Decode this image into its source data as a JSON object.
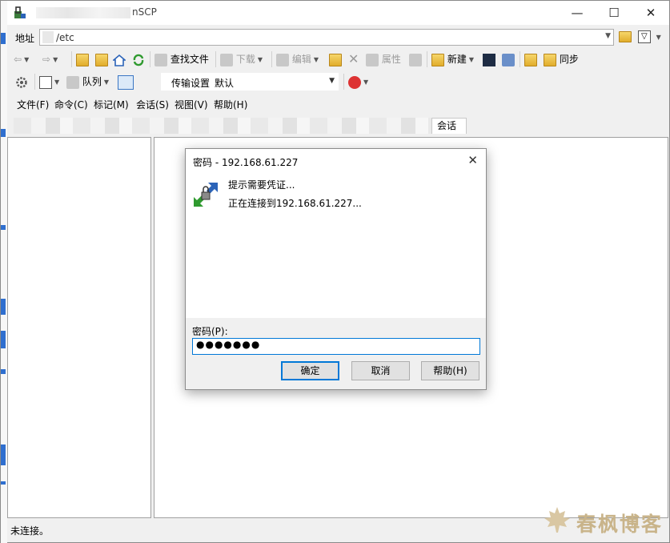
{
  "window": {
    "title_visible": "nSCP",
    "minimize": "—",
    "maximize": "☐",
    "close": "✕"
  },
  "address": {
    "label": "地址",
    "path": "/etc"
  },
  "toolbar1": {
    "find_files": "查找文件",
    "download": "下载",
    "edit": "编辑",
    "properties": "属性",
    "new": "新建",
    "sync": "同步"
  },
  "toolbar2": {
    "queue": "队列",
    "transfer_settings_label": "传输设置",
    "transfer_settings_value": "默认"
  },
  "menu": [
    "文件(F)",
    "命令(C)",
    "标记(M)",
    "会话(S)",
    "视图(V)",
    "帮助(H)"
  ],
  "tab": {
    "label": "会话"
  },
  "status": {
    "text": "未连接。"
  },
  "watermark": {
    "text": "春枫博客"
  },
  "dialog": {
    "title": "密码 - 192.168.61.227",
    "close": "✕",
    "message1": "提示需要凭证...",
    "message2": "正在连接到192.168.61.227...",
    "password_label": "密码(P):",
    "password_value": "●●●●●●●",
    "ok": "确定",
    "cancel": "取消",
    "help": "帮助(H)"
  },
  "colors": {
    "accent": "#0078d7",
    "folder": "#e1ad2c",
    "watermark": "#c9b48a"
  }
}
